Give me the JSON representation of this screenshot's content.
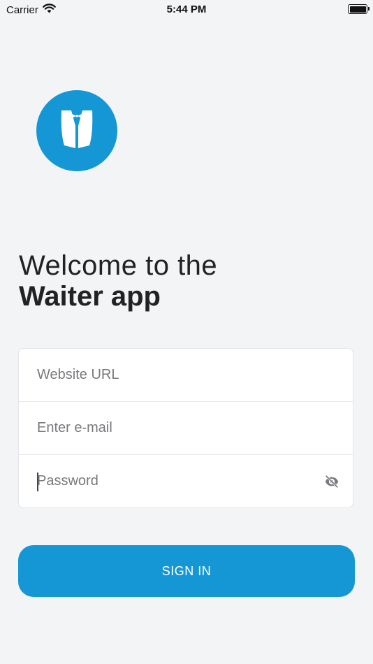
{
  "status_bar": {
    "carrier": "Carrier",
    "time": "5:44 PM"
  },
  "icons": {
    "wifi": "wifi-icon",
    "battery": "battery-icon",
    "logo": "waiter-tuxedo-icon",
    "visibility": "eye-off-icon"
  },
  "welcome": {
    "line1": "Welcome to the",
    "line2": "Waiter app"
  },
  "form": {
    "website_url_placeholder": "Website URL",
    "email_placeholder": "Enter e-mail",
    "password_placeholder": "Password"
  },
  "sign_in": {
    "label": "SIGN IN"
  },
  "colors": {
    "accent": "#1597d5",
    "background": "#f3f4f6",
    "text": "#222222"
  }
}
